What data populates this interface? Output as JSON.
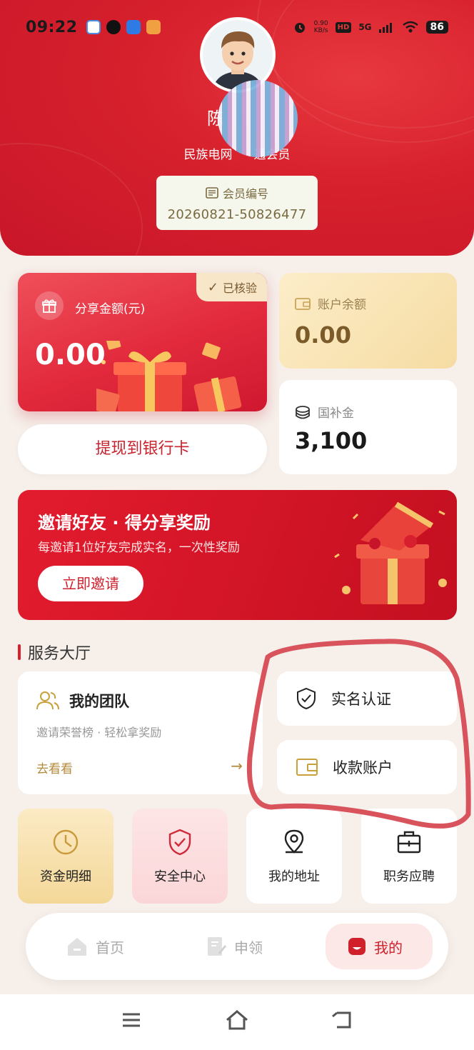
{
  "status_bar": {
    "time": "09:22",
    "speed_value": "0.90",
    "speed_unit": "KB/s",
    "hd": "HD",
    "network": "5G",
    "battery": "86"
  },
  "profile": {
    "name_visible": "陈",
    "member_type_prefix": "民族电网",
    "member_type_suffix": "通会员",
    "member_label": "会员编号",
    "member_number": "20260821-50826477"
  },
  "share": {
    "verified": "已核验",
    "title": "分享金额(元)",
    "amount": "0.00",
    "withdraw": "提现到银行卡"
  },
  "balance": {
    "title": "账户余额",
    "amount": "0.00"
  },
  "subsidy": {
    "title": "国补金",
    "amount": "3,100"
  },
  "invite": {
    "title": "邀请好友 · 得分享奖励",
    "subtitle": "每邀请1位好友完成实名，一次性奖励",
    "button": "立即邀请"
  },
  "services": {
    "section_title": "服务大厅",
    "team": {
      "title": "我的团队",
      "subtitle": "邀请荣誉榜 · 轻松拿奖励",
      "link": "去看看"
    },
    "auth": "实名认证",
    "pay_account": "收款账户",
    "tiles": [
      "资金明细",
      "安全中心",
      "我的地址",
      "职务应聘"
    ]
  },
  "tabbar": {
    "home": "首页",
    "apply": "申领",
    "mine": "我的"
  },
  "colors": {
    "primary_red": "#d6202c",
    "gold_text": "#7b5b2a",
    "annotation_red": "#d9535c"
  }
}
